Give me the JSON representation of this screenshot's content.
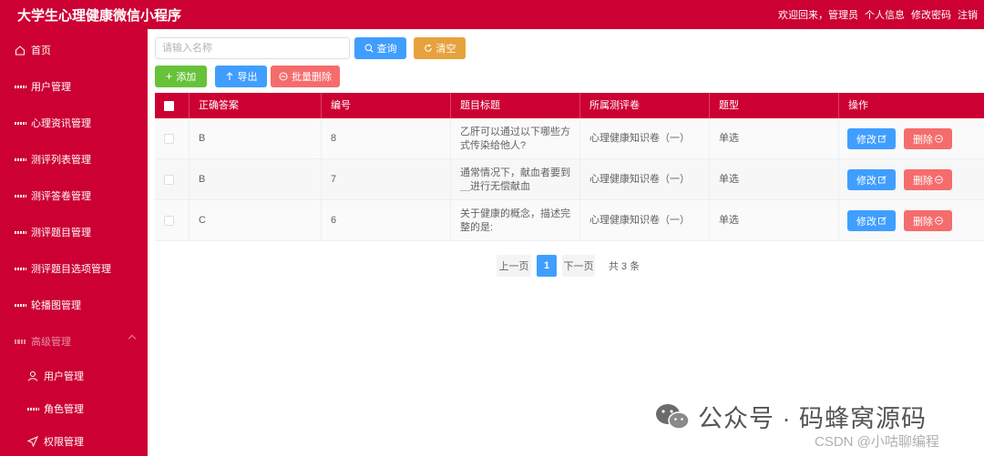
{
  "header": {
    "title": "大学生心理健康微信小程序",
    "welcome": "欢迎回来，管理员",
    "links": [
      "个人信息",
      "修改密码",
      "注销"
    ]
  },
  "sidebar": {
    "items": [
      {
        "label": "首页",
        "icon": "home-icon"
      },
      {
        "label": "用户管理",
        "icon": "grid-icon"
      },
      {
        "label": "心理资讯管理",
        "icon": "grid-icon"
      },
      {
        "label": "测评列表管理",
        "icon": "grid-icon"
      },
      {
        "label": "测评答卷管理",
        "icon": "grid-icon"
      },
      {
        "label": "测评题目管理",
        "icon": "grid-icon"
      },
      {
        "label": "测评题目选项管理",
        "icon": "grid-icon"
      },
      {
        "label": "轮播图管理",
        "icon": "grid-icon"
      },
      {
        "label": "高级管理",
        "icon": "grid-icon"
      }
    ],
    "sub_items": [
      {
        "label": "用户管理",
        "icon": "user-icon"
      },
      {
        "label": "角色管理",
        "icon": "grid-icon"
      },
      {
        "label": "权限管理",
        "icon": "send-icon"
      }
    ]
  },
  "toolbar": {
    "search_placeholder": "请输入名称",
    "query_label": "查询",
    "clear_label": "清空",
    "add_label": "添加",
    "export_label": "导出",
    "batch_delete_label": "批量删除"
  },
  "table": {
    "columns": [
      "正确答案",
      "编号",
      "题目标题",
      "所属测评卷",
      "题型",
      "操作"
    ],
    "rows": [
      {
        "answer": "B",
        "id": "8",
        "title": "乙肝可以通过以下哪些方式传染给他人?",
        "paper": "心理健康知识卷（一）",
        "type": "单选"
      },
      {
        "answer": "B",
        "id": "7",
        "title": "通常情况下，献血者要到＿进行无偿献血",
        "paper": "心理健康知识卷（一）",
        "type": "单选"
      },
      {
        "answer": "C",
        "id": "6",
        "title": "关于健康的概念，描述完整的是:",
        "paper": "心理健康知识卷（一）",
        "type": "单选"
      }
    ],
    "edit_label": "修改",
    "delete_label": "删除"
  },
  "pagination": {
    "prev_label": "上一页",
    "current_page": "1",
    "next_label": "下一页",
    "total_label": "共 3 条"
  },
  "watermark": {
    "text": "公众号 · 码蜂窝源码",
    "csdn": "CSDN @小咕聊编程"
  },
  "colors": {
    "brand": "#cc0033",
    "primary": "#409eff",
    "warning": "#e6a23c",
    "success": "#67c23a",
    "danger": "#f56c6c"
  }
}
